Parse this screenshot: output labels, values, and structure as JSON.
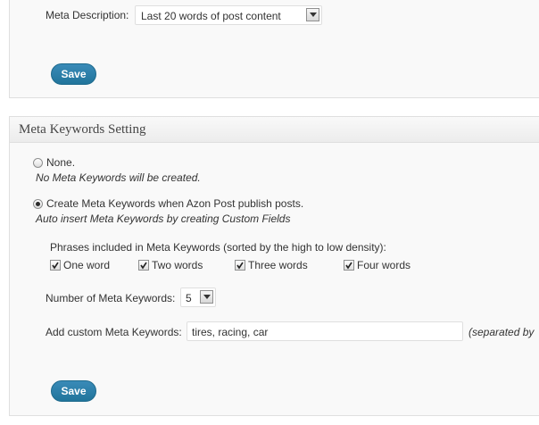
{
  "meta_description": {
    "label": "Meta Description:",
    "selected": "Last 20 words of post content"
  },
  "top_save_label": "Save",
  "meta_keywords_panel": {
    "title": "Meta Keywords Setting",
    "option_none": {
      "label": "None.",
      "hint": "No Meta Keywords will be created.",
      "checked": false
    },
    "option_create": {
      "label": "Create Meta Keywords when Azon Post publish posts.",
      "hint": "Auto insert Meta Keywords by creating Custom Fields",
      "checked": true
    },
    "phrases_label": "Phrases included in Meta Keywords (sorted by the high to low density):",
    "phrases": [
      {
        "label": "One word",
        "checked": true
      },
      {
        "label": "Two words",
        "checked": true
      },
      {
        "label": "Three words",
        "checked": true
      },
      {
        "label": "Four words",
        "checked": true
      }
    ],
    "number_label": "Number of Meta Keywords:",
    "number_value": "5",
    "custom_label": "Add custom Meta Keywords:",
    "custom_value": "tires, racing, car",
    "custom_hint": "(separated by",
    "save_label": "Save"
  },
  "colors": {
    "accent": "#21759b",
    "panel_bg": "#f9f9f9",
    "border": "#dfdfdf"
  }
}
